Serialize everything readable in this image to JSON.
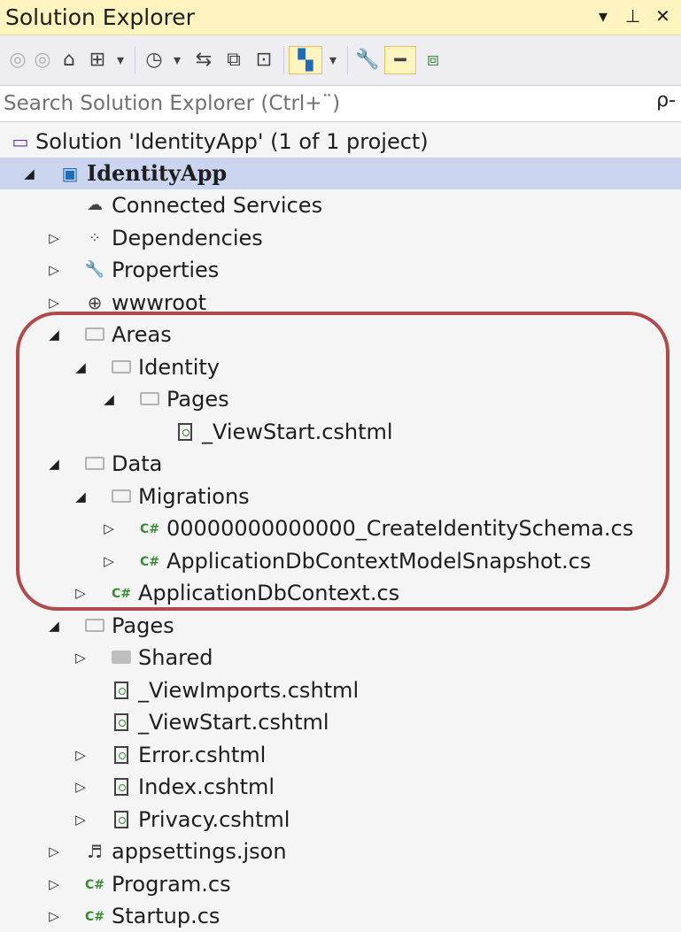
{
  "titlebar": {
    "title": "Solution Explorer",
    "controls": [
      "▾",
      "⊥",
      "✕"
    ]
  },
  "toolbar": {
    "buttons": [
      {
        "name": "back-icon",
        "glyph": "◎"
      },
      {
        "name": "forward-icon",
        "glyph": "◎"
      },
      {
        "name": "home-icon",
        "glyph": "⌂"
      },
      {
        "name": "switch-views-icon",
        "glyph": "⊞"
      },
      {
        "name": "dropdown-arrow-icon",
        "glyph": "▾"
      },
      {
        "name": "pending-changes-icon",
        "glyph": "◷"
      },
      {
        "name": "dropdown-arrow-icon",
        "glyph": "▾"
      },
      {
        "name": "sync-icon",
        "glyph": "⇆"
      },
      {
        "name": "collapse-all-icon",
        "glyph": "⧉"
      },
      {
        "name": "show-all-files-icon",
        "glyph": "⊡"
      },
      {
        "name": "preview-selected-icon",
        "glyph": "▚"
      },
      {
        "name": "dropdown-arrow-icon",
        "glyph": "▾"
      },
      {
        "name": "properties-wrench-icon",
        "glyph": "🔧"
      },
      {
        "name": "pin-active-icon",
        "glyph": "━"
      },
      {
        "name": "class-view-icon",
        "glyph": "⧈"
      }
    ]
  },
  "search": {
    "placeholder": "Search Solution Explorer (Ctrl+¨)",
    "icon_glyph": "ρ‐"
  },
  "tree": {
    "nodes": [
      {
        "label": "Solution 'IdentityApp' (1 of 1 project)",
        "icon": "solution-icon",
        "expander": "",
        "depth": 0
      },
      {
        "label": "IdentityApp",
        "icon": "web-project-icon",
        "expander": "◢",
        "depth": 0
      },
      {
        "label": "Connected Services",
        "icon": "connected-services-icon",
        "expander": "",
        "depth": 1
      },
      {
        "label": "Dependencies",
        "icon": "dependencies-icon",
        "expander": "▷",
        "depth": 1
      },
      {
        "label": "Properties",
        "icon": "wrench-icon",
        "expander": "▷",
        "depth": 1
      },
      {
        "label": "wwwroot",
        "icon": "globe-icon",
        "expander": "▷",
        "depth": 1
      },
      {
        "label": "Areas",
        "icon": "folder-open-icon",
        "expander": "◢",
        "depth": 1
      },
      {
        "label": "Identity",
        "icon": "folder-open-icon",
        "expander": "◢",
        "depth": 2
      },
      {
        "label": "Pages",
        "icon": "folder-open-icon",
        "expander": "◢",
        "depth": 3
      },
      {
        "label": "_ViewStart.cshtml",
        "icon": "razor-file-icon",
        "expander": "",
        "depth": 4
      },
      {
        "label": "Data",
        "icon": "folder-open-icon",
        "expander": "◢",
        "depth": 1
      },
      {
        "label": "Migrations",
        "icon": "folder-open-icon",
        "expander": "◢",
        "depth": 2
      },
      {
        "label": "00000000000000_CreateIdentitySchema.cs",
        "icon": "csharp-file-icon",
        "expander": "▷",
        "depth": 3
      },
      {
        "label": "ApplicationDbContextModelSnapshot.cs",
        "icon": "csharp-file-icon",
        "expander": "▷",
        "depth": 3
      },
      {
        "label": "ApplicationDbContext.cs",
        "icon": "csharp-file-icon",
        "expander": "▷",
        "depth": 2
      },
      {
        "label": "Pages",
        "icon": "folder-open-icon",
        "expander": "◢",
        "depth": 1
      },
      {
        "label": "Shared",
        "icon": "folder-closed-icon",
        "expander": "▷",
        "depth": 2
      },
      {
        "label": "_ViewImports.cshtml",
        "icon": "razor-file-icon",
        "expander": "",
        "depth": 2
      },
      {
        "label": "_ViewStart.cshtml",
        "icon": "razor-file-icon",
        "expander": "",
        "depth": 2
      },
      {
        "label": "Error.cshtml",
        "icon": "razor-file-icon",
        "expander": "▷",
        "depth": 2
      },
      {
        "label": "Index.cshtml",
        "icon": "razor-file-icon",
        "expander": "▷",
        "depth": 2
      },
      {
        "label": "Privacy.cshtml",
        "icon": "razor-file-icon",
        "expander": "▷",
        "depth": 2
      },
      {
        "label": "appsettings.json",
        "icon": "json-file-icon",
        "expander": "▷",
        "depth": 1
      },
      {
        "label": "Program.cs",
        "icon": "csharp-file-icon",
        "expander": "▷",
        "depth": 1
      },
      {
        "label": "Startup.cs",
        "icon": "csharp-file-icon",
        "expander": "▷",
        "depth": 1
      }
    ]
  },
  "colors": {
    "titlebar_bg": "#fdf4bf",
    "selected_row": "#ccd5f0",
    "annotation_ring": "#b14b4b",
    "csharp_green": "#388a34"
  }
}
